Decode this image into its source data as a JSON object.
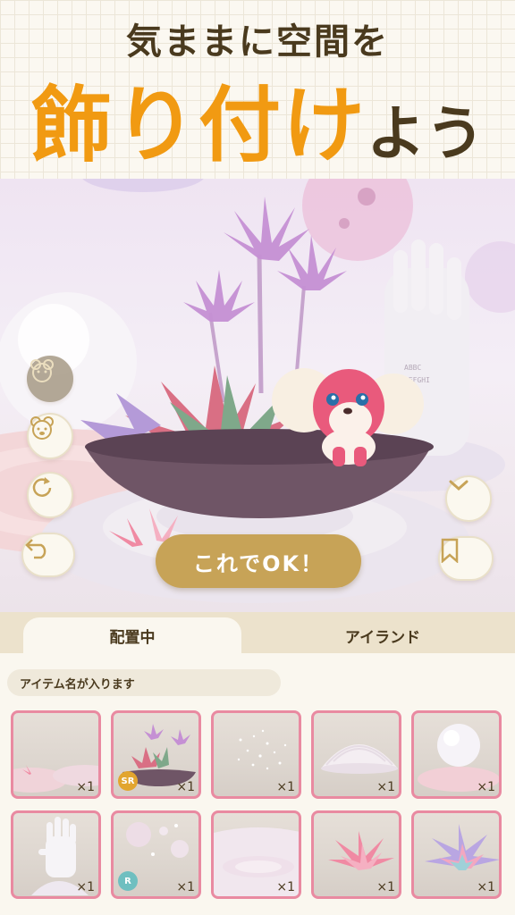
{
  "banner": {
    "line1": "気ままに空間を",
    "line2_big": "飾り付け",
    "line2_small": "よう"
  },
  "scene": {
    "ok_button": "これでOK！"
  },
  "tabs": [
    {
      "label": "配置中",
      "active": true
    },
    {
      "label": "アイランド",
      "active": false
    }
  ],
  "item_name_placeholder": "アイテム名が入ります",
  "items": [
    {
      "qty": "×1",
      "icon": "pink-hill-icon"
    },
    {
      "qty": "×1",
      "icon": "plant-bowl-icon",
      "rarity": "SR"
    },
    {
      "qty": "×1",
      "icon": "sparkles-icon"
    },
    {
      "qty": "×1",
      "icon": "dome-icon"
    },
    {
      "qty": "×1",
      "icon": "orb-icon"
    },
    {
      "qty": "×1",
      "icon": "hand-statue-icon"
    },
    {
      "qty": "×1",
      "icon": "bubbles-icon",
      "rarity": "R"
    },
    {
      "qty": "×1",
      "icon": "pink-ground-icon"
    },
    {
      "qty": "×1",
      "icon": "pink-succulent-icon"
    },
    {
      "qty": "×1",
      "icon": "pastel-succulent-icon"
    }
  ],
  "colors": {
    "accent_orange": "#f19a12",
    "brand_brown": "#4a3a1e",
    "ok_gold": "#c7a357",
    "card_border": "#e98aa1"
  }
}
